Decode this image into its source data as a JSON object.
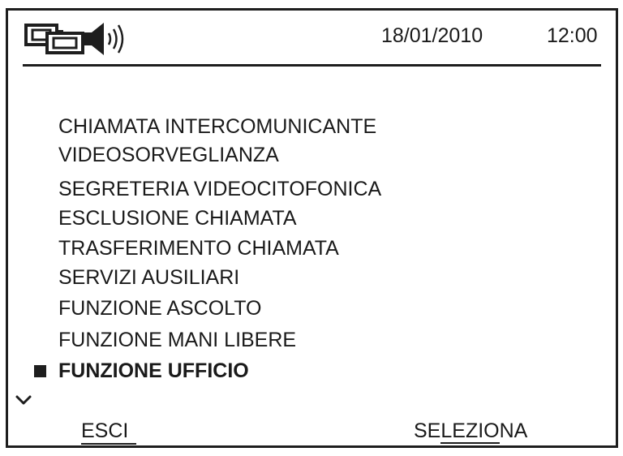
{
  "status_bar": {
    "network_icon": "intercom-network-icon",
    "speaker_icon": "speaker-volume-icon",
    "date": "18/01/2010",
    "time": "12:00"
  },
  "menu": {
    "items": [
      {
        "label": "CHIAMATA INTERCOMUNICANTE",
        "selected": false
      },
      {
        "label": "VIDEOSORVEGLIANZA",
        "selected": false
      },
      {
        "label": "SEGRETERIA VIDEOCITOFONICA",
        "selected": false
      },
      {
        "label": "ESCLUSIONE CHIAMATA",
        "selected": false
      },
      {
        "label": "TRASFERIMENTO CHIAMATA",
        "selected": false
      },
      {
        "label": "SERVIZI AUSILIARI",
        "selected": false
      },
      {
        "label": "FUNZIONE ASCOLTO",
        "selected": false
      },
      {
        "label": "FUNZIONE MANI LIBERE",
        "selected": false
      },
      {
        "label": "FUNZIONE UFFICIO",
        "selected": true
      }
    ],
    "more_indicator_icon": "chevron-down-icon"
  },
  "softkeys": {
    "left_label": "ESCI",
    "right_label_part1": "SE",
    "right_label_part2": "LEZIO",
    "right_label_part3": "NA"
  }
}
